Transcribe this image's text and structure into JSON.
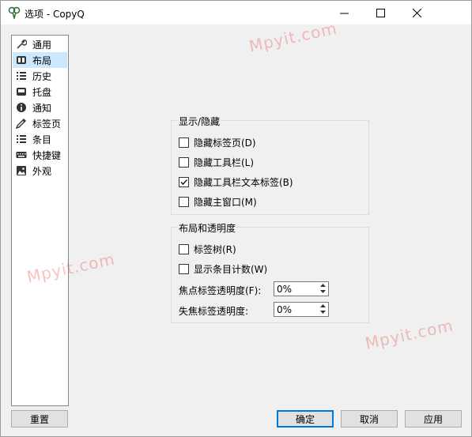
{
  "window": {
    "title": "选项 - CopyQ",
    "controls": {
      "minimize": "—",
      "maximize": "☐",
      "close": "✕"
    }
  },
  "sidebar": {
    "items": [
      {
        "label": "通用",
        "icon": "wrench-icon",
        "selected": false
      },
      {
        "label": "布局",
        "icon": "layout-icon",
        "selected": true
      },
      {
        "label": "历史",
        "icon": "list-icon",
        "selected": false
      },
      {
        "label": "托盘",
        "icon": "tray-icon",
        "selected": false
      },
      {
        "label": "通知",
        "icon": "info-icon",
        "selected": false
      },
      {
        "label": "标签页",
        "icon": "tag-icon",
        "selected": false
      },
      {
        "label": "条目",
        "icon": "list-icon",
        "selected": false
      },
      {
        "label": "快捷键",
        "icon": "keyboard-icon",
        "selected": false
      },
      {
        "label": "外观",
        "icon": "image-icon",
        "selected": false
      }
    ]
  },
  "show_hide": {
    "title": "显示/隐藏",
    "options": [
      {
        "label": "隐藏标签页(D)",
        "checked": false
      },
      {
        "label": "隐藏工具栏(L)",
        "checked": false
      },
      {
        "label": "隐藏工具栏文本标签(B)",
        "checked": true
      },
      {
        "label": "隐藏主窗口(M)",
        "checked": false
      }
    ]
  },
  "layout_transparency": {
    "title": "布局和透明度",
    "options": [
      {
        "label": "标签树(R)",
        "checked": false
      },
      {
        "label": "显示条目计数(W)",
        "checked": false
      }
    ],
    "focused_label": "焦点标签透明度(F):",
    "focused_value": "0%",
    "unfocused_label": "失焦标签透明度:",
    "unfocused_value": "0%"
  },
  "buttons": {
    "reset": "重置",
    "ok": "确定",
    "cancel": "取消",
    "apply": "应用"
  },
  "watermark": "Mpyit.com",
  "colors": {
    "selected_bg": "#cce8ff",
    "default_button_border": "#0078d7",
    "watermark": "#e65050"
  }
}
